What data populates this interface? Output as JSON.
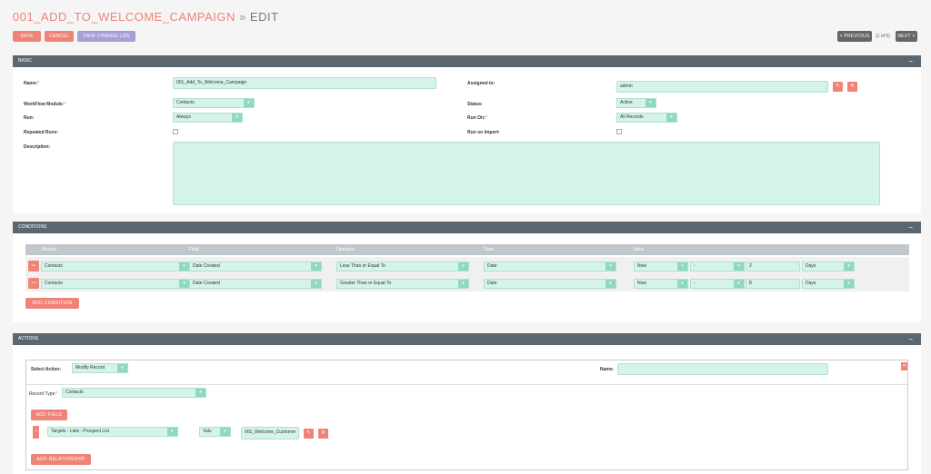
{
  "header": {
    "record_name": "001_ADD_TO_WELCOME_CAMPAIGN",
    "separator": "»",
    "mode": "EDIT"
  },
  "toolbar": {
    "save": "SAVE",
    "cancel": "CANCEL",
    "view_change_log": "VIEW CHANGE LOG",
    "previous": "< PREVIOUS",
    "pager": "(1 of 5)",
    "next": "NEXT >"
  },
  "basic": {
    "title": "BASIC",
    "collapse": "−",
    "name_label": "Name:",
    "name_value": "001_Add_To_Welcome_Campaign",
    "assigned_label": "Assigned to:",
    "assigned_value": "admin",
    "module_label": "WorkFlow Module:",
    "module_value": "Contacts",
    "status_label": "Status:",
    "status_value": "Active",
    "run_label": "Run:",
    "run_value": "Always",
    "run_on_label": "Run On:",
    "run_on_value": "All Records",
    "repeated_label": "Repeated Runs:",
    "run_import_label": "Run on Import:",
    "description_label": "Description:",
    "required_mark": "*"
  },
  "conditions": {
    "title": "CONDITIONS",
    "collapse": "−",
    "columns": [
      "Module",
      "Field",
      "Operator",
      "Type",
      "Value"
    ],
    "rows": [
      {
        "module": "Contacts",
        "field": "Date Created",
        "operator": "Less Than or Equal To",
        "type": "Date",
        "v1": "Now",
        "v2": "-",
        "v3": "2",
        "v4": "Days"
      },
      {
        "module": "Contacts",
        "field": "Date Created",
        "operator": "Greater Than or Equal To",
        "type": "Date",
        "v1": "Now",
        "v2": "-",
        "v3": "8",
        "v4": "Days"
      }
    ],
    "add_condition": "ADD CONDITION"
  },
  "actions": {
    "title": "ACTIONS",
    "collapse": "−",
    "select_action_label": "Select Action:",
    "select_action_value": "Modify Record",
    "name_label": "Name:",
    "record_type_label": "Record Type:",
    "record_type_value": "Contacts",
    "add_field": "ADD FIELD",
    "relationship_field": "Targets - Lists : Prospect List",
    "relationship_type": "Valu",
    "relationship_value": "001_Welcome_Customer",
    "add_relationship": "ADD RELATIONSHIP"
  },
  "icons": {
    "select_arrow": "▾",
    "arrow_icon": "↖",
    "clear_icon": "✕",
    "remove_icon": "−"
  },
  "colors": {
    "accent": "#f08377",
    "panel_header": "#5b6770",
    "input_bg": "#d4f4ea",
    "purple": "#a5a0d6"
  }
}
